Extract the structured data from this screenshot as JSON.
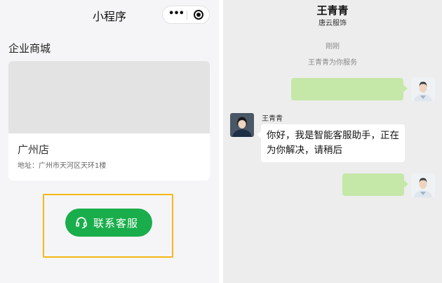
{
  "miniapp": {
    "title": "小程序",
    "section_title": "企业商城",
    "store": {
      "name": "广州店",
      "address": "地址：广州市天河区天环1楼"
    },
    "contact_button": "联系客服",
    "highlight_color": "#f5b716",
    "button_color": "#1aad4b"
  },
  "chat": {
    "contact_name": "王青青",
    "contact_company": "唐云服饰",
    "timestamp": "刚刚",
    "system_notice": "王青青为你服务",
    "agent_name": "王青青",
    "agent_message": "你好，我是智能客服助手，正在为你解决，请稍后",
    "outgoing_bubble_color": "#c5e8a8"
  }
}
